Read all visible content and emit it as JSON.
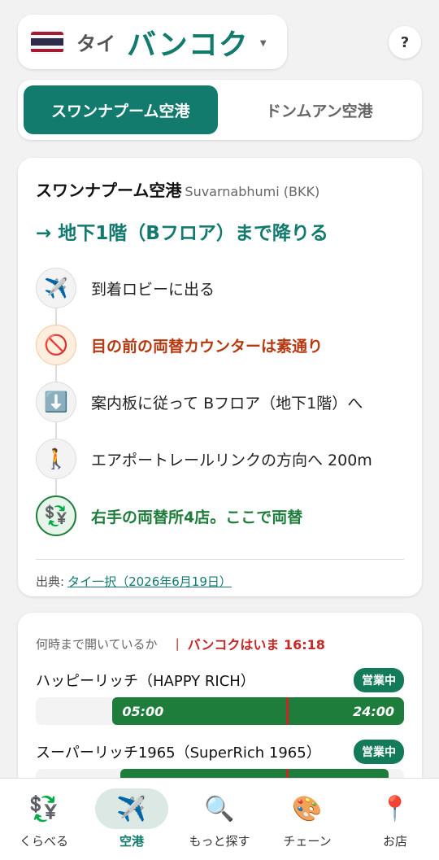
{
  "header": {
    "flag_icon": "thailand-flag-icon",
    "country": "タイ",
    "city": "バンコク",
    "help_label": "?"
  },
  "tabs": [
    {
      "label": "スワンナプーム空港",
      "active": true
    },
    {
      "label": "ドンムアン空港",
      "active": false
    }
  ],
  "guide": {
    "airport_name": "スワンナプーム空港",
    "airport_sub": "Suvarnabhumi (BKK)",
    "headline": "→ 地下1階（Bフロア）まで降りる",
    "steps": [
      {
        "icon": "✈️",
        "icon_name": "airplane-icon",
        "text": "到着ロビーに出る",
        "style": "normal"
      },
      {
        "icon": "🚫",
        "icon_name": "prohibited-icon",
        "text": "目の前の両替カウンターは素通り",
        "style": "warn"
      },
      {
        "icon": "⬇️",
        "icon_name": "down-arrow-icon",
        "text": "案内板に従って Bフロア（地下1階）へ",
        "style": "normal"
      },
      {
        "icon": "🚶",
        "icon_name": "walking-person-icon",
        "text": "エアポートレールリンクの方向へ 200m",
        "style": "normal"
      },
      {
        "icon": "💱",
        "icon_name": "exchange-shop-icon",
        "text": "右手の両替所4店。ここで両替",
        "style": "ok"
      }
    ],
    "source_label": "出典:",
    "source_link": "タイ一択（2026年6月19日）"
  },
  "hours": {
    "heading": "何時まで開いているか",
    "separator": "|",
    "now_label": "バンコクはいま 16:18",
    "now_time": 16.3,
    "shops": [
      {
        "name": "ハッピーリッチ（HAPPY RICH）",
        "status": "営業中",
        "open": "05:00",
        "close": "24:00",
        "open_h": 5,
        "close_h": 24
      },
      {
        "name": "スーパーリッチ1965（SuperRich 1965）",
        "status": "営業中",
        "open": "",
        "close": "",
        "open_h": 5.5,
        "close_h": 23
      }
    ]
  },
  "nav": [
    {
      "icon": "💱",
      "icon_name": "currency-exchange-icon",
      "label": "くらべる",
      "active": false
    },
    {
      "icon": "✈️",
      "icon_name": "airplane-icon",
      "label": "空港",
      "active": true
    },
    {
      "icon": "🔍",
      "icon_name": "search-icon",
      "label": "もっと探す",
      "active": false
    },
    {
      "icon": "🎨",
      "icon_name": "palette-icon",
      "label": "チェーン",
      "active": false
    },
    {
      "icon": "📍",
      "icon_name": "pin-icon",
      "label": "お店",
      "active": false
    }
  ],
  "colors": {
    "accent": "#137a6e",
    "open_bar": "#1e7d3b",
    "now_line": "#c62828",
    "warn": "#b53a12"
  }
}
